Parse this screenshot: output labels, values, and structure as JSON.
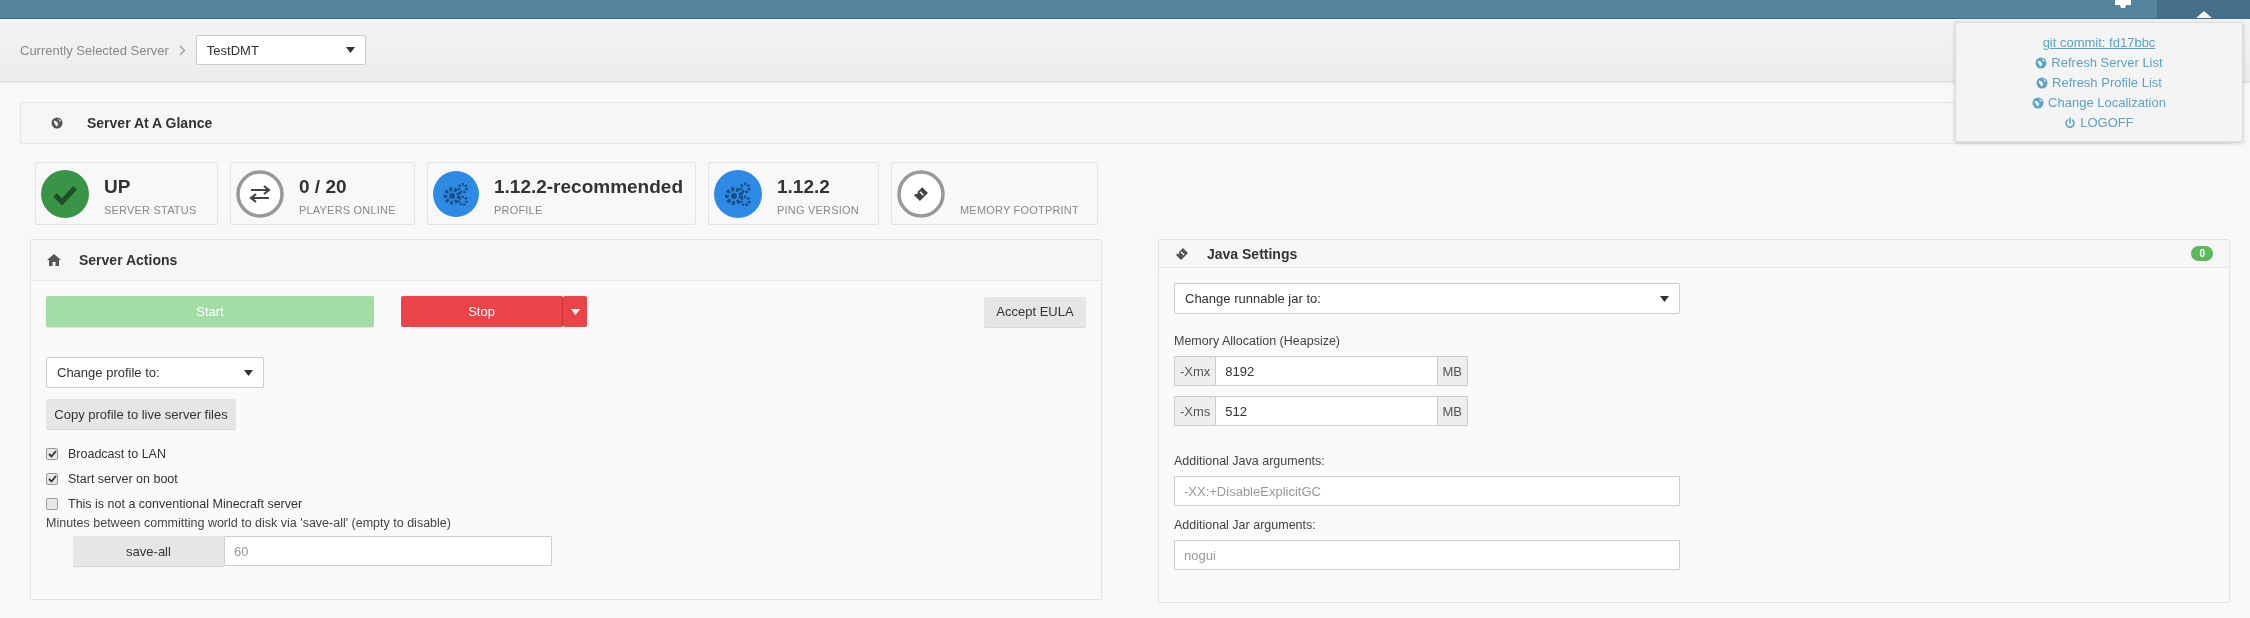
{
  "server_selector": {
    "label": "Currently Selected Server",
    "value": "TestDMT"
  },
  "user_menu": {
    "items": [
      {
        "kind": "link",
        "label": "git commit: fd17bbc"
      },
      {
        "kind": "globe",
        "label": "Refresh Server List"
      },
      {
        "kind": "globe",
        "label": "Refresh Profile List"
      },
      {
        "kind": "globe",
        "label": "Change Localization"
      },
      {
        "kind": "power",
        "label": "LOGOFF"
      }
    ]
  },
  "glance": {
    "title": "Server At A Glance",
    "cards": [
      {
        "kind": "check",
        "value": "UP",
        "label": "SERVER STATUS"
      },
      {
        "kind": "arrows",
        "value": "0 / 20",
        "label": "PLAYERS ONLINE"
      },
      {
        "kind": "gears",
        "value": "1.12.2-recommended",
        "label": "PROFILE"
      },
      {
        "kind": "gears",
        "value": "1.12.2",
        "label": "PING VERSION"
      },
      {
        "kind": "ticket",
        "label": "MEMORY FOOTPRINT"
      }
    ]
  },
  "server_actions": {
    "title": "Server Actions",
    "start": {
      "label": "Start",
      "disabled": true
    },
    "stop": {
      "label": "Stop"
    },
    "accept_eula": {
      "label": "Accept EULA"
    },
    "profile_select": {
      "value": "Change profile to:"
    },
    "copy_button": {
      "label": "Copy profile to live server files"
    },
    "options": [
      {
        "label": "Broadcast to LAN",
        "checked": true
      },
      {
        "label": "Start server on boot",
        "checked": true
      },
      {
        "label": "This is not a conventional Minecraft server",
        "checked": false
      }
    ],
    "save_all": {
      "label": "Minutes between committing world to disk via 'save-all' (empty to disable)",
      "button": "save-all",
      "placeholder": "60"
    }
  },
  "java_settings": {
    "title": "Java Settings",
    "badge": "0",
    "jar_select": {
      "value": "Change runnable jar to:"
    },
    "memory_label": "Memory Allocation (Heapsize)",
    "memory": [
      {
        "prefix": "-Xmx",
        "value": "8192",
        "unit": "MB"
      },
      {
        "prefix": "-Xms",
        "value": "512",
        "unit": "MB"
      }
    ],
    "java_args": {
      "label": "Additional Java arguments:",
      "placeholder": "-XX:+DisableExplicitGC"
    },
    "jar_args": {
      "label": "Additional Jar arguments:",
      "placeholder": "nogui"
    }
  }
}
